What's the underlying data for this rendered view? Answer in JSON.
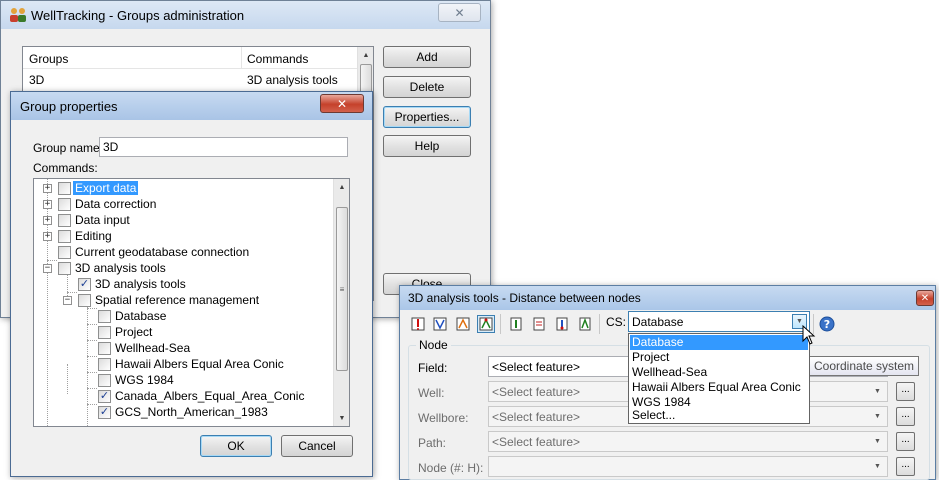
{
  "groups_window": {
    "title": "WellTracking - Groups administration",
    "columns": [
      "Groups",
      "Commands"
    ],
    "rows": [
      {
        "group": "3D",
        "command": "3D analysis tools"
      }
    ],
    "buttons": {
      "add": "Add",
      "delete": "Delete",
      "properties": "Properties...",
      "help": "Help",
      "close": "Close"
    }
  },
  "group_props": {
    "title": "Group properties",
    "group_name_label": "Group name:",
    "group_name_value": "3D",
    "commands_label": "Commands:",
    "tree": [
      {
        "label": "Export data",
        "checked": false,
        "selected": true
      },
      {
        "label": "Data correction",
        "checked": false
      },
      {
        "label": "Data input",
        "checked": false
      },
      {
        "label": "Editing",
        "checked": false
      },
      {
        "label": "Current geodatabase connection",
        "checked": false
      },
      {
        "label": "3D analysis tools",
        "checked": false
      },
      {
        "label": "3D analysis tools",
        "checked": true
      },
      {
        "label": "Spatial reference management",
        "checked": false
      },
      {
        "label": "Database",
        "checked": false
      },
      {
        "label": "Project",
        "checked": false
      },
      {
        "label": "Wellhead-Sea",
        "checked": false
      },
      {
        "label": "Hawaii Albers Equal Area Conic",
        "checked": false
      },
      {
        "label": "WGS 1984",
        "checked": false
      },
      {
        "label": "Canada_Albers_Equal_Area_Conic",
        "checked": true
      },
      {
        "label": "GCS_North_American_1983",
        "checked": true
      }
    ],
    "ok": "OK",
    "cancel": "Cancel"
  },
  "distance_window": {
    "title": "3D analysis tools - Distance between nodes",
    "toolbar_icons": [
      "well-warning-icon",
      "well-path-icon",
      "well-edit-icon",
      "well-active-icon",
      "node-icon",
      "node-list-icon",
      "node-table-icon",
      "node-measure-icon",
      "help-icon"
    ],
    "cs_label": "CS:",
    "cs_value": "Database",
    "cs_options": [
      "Database",
      "Project",
      "Wellhead-Sea",
      "Hawaii Albers Equal Area Conic",
      "WGS 1984",
      "Select..."
    ],
    "tooltip": "Coordinate system",
    "node_group": "Node",
    "fields": [
      {
        "label": "Field:",
        "placeholder": "<Select feature>",
        "enabled": true
      },
      {
        "label": "Well:",
        "placeholder": "<Select feature>",
        "enabled": false
      },
      {
        "label": "Wellbore:",
        "placeholder": "<Select feature>",
        "enabled": false
      },
      {
        "label": "Path:",
        "placeholder": "<Select feature>",
        "enabled": false
      },
      {
        "label": "Node (#: H):",
        "placeholder": "",
        "enabled": false
      }
    ],
    "ellipsis": "..."
  }
}
